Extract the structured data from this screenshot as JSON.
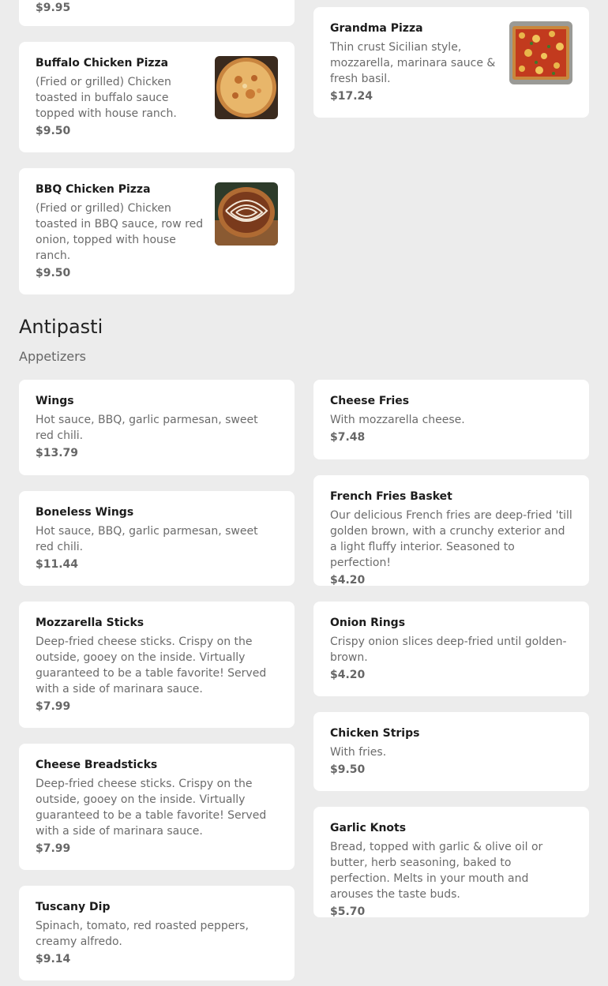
{
  "pizza_cards": {
    "partial": {
      "price": "$9.95"
    },
    "buffalo": {
      "name": "Buffalo Chicken Pizza",
      "desc": "(Fried or grilled) Chicken toasted in buffalo sauce topped with house ranch.",
      "price": "$9.50",
      "image_icon": "buffalo-chicken-pizza-photo"
    },
    "bbq": {
      "name": "BBQ Chicken Pizza",
      "desc": "(Fried or grilled) Chicken toasted in BBQ sauce, row red onion, topped with house ranch.",
      "price": "$9.50",
      "image_icon": "bbq-chicken-pizza-photo"
    },
    "grandma": {
      "name": "Grandma Pizza",
      "desc": "Thin crust Sicilian style, mozzarella, marinara sauce & fresh basil.",
      "price": "$17.24",
      "image_icon": "grandma-pizza-photo"
    }
  },
  "antipasti": {
    "title": "Antipasti",
    "subtitle": "Appetizers",
    "left_column": [
      {
        "name": "Wings",
        "desc": "Hot sauce, BBQ, garlic parmesan, sweet red chili.",
        "price": "$13.79"
      },
      {
        "name": "Boneless Wings",
        "desc": "Hot sauce, BBQ, garlic parmesan, sweet red chili.",
        "price": "$11.44"
      },
      {
        "name": "Mozzarella Sticks",
        "desc": "Deep-fried cheese sticks. Crispy on the outside, gooey on the inside. Virtually guaranteed to be a table favorite! Served with a side of marinara sauce.",
        "price": "$7.99"
      },
      {
        "name": "Cheese Breadsticks",
        "desc": "Deep-fried cheese sticks. Crispy on the outside, gooey on the inside. Virtually guaranteed to be a table favorite! Served with a side of marinara sauce.",
        "price": "$7.99"
      },
      {
        "name": "Tuscany Dip",
        "desc": "Spinach, tomato, red roasted peppers, creamy alfredo.",
        "price": "$9.14"
      }
    ],
    "right_column": [
      {
        "name": "Cheese Fries",
        "desc": "With mozzarella cheese.",
        "price": "$7.48"
      },
      {
        "name": "French Fries Basket",
        "desc": "Our delicious French fries are deep-fried 'till golden brown, with a crunchy exterior and a light fluffy interior. Seasoned to perfection!",
        "price": "$4.20"
      },
      {
        "name": "Onion Rings",
        "desc": "Crispy onion slices deep-fried until golden-brown.",
        "price": "$4.20"
      },
      {
        "name": "Chicken Strips",
        "desc": "With fries.",
        "price": "$9.50"
      },
      {
        "name": "Garlic Knots",
        "desc": "Bread, topped with garlic & olive oil or butter, herb seasoning, baked to perfection. Melts in your mouth and arouses the taste buds.",
        "price": "$5.70"
      }
    ]
  },
  "colors": {
    "background": "#ececec",
    "card": "#ffffff",
    "name_text": "#1c1c1c",
    "desc_text": "#6b6b6b",
    "price_text": "#666666"
  }
}
